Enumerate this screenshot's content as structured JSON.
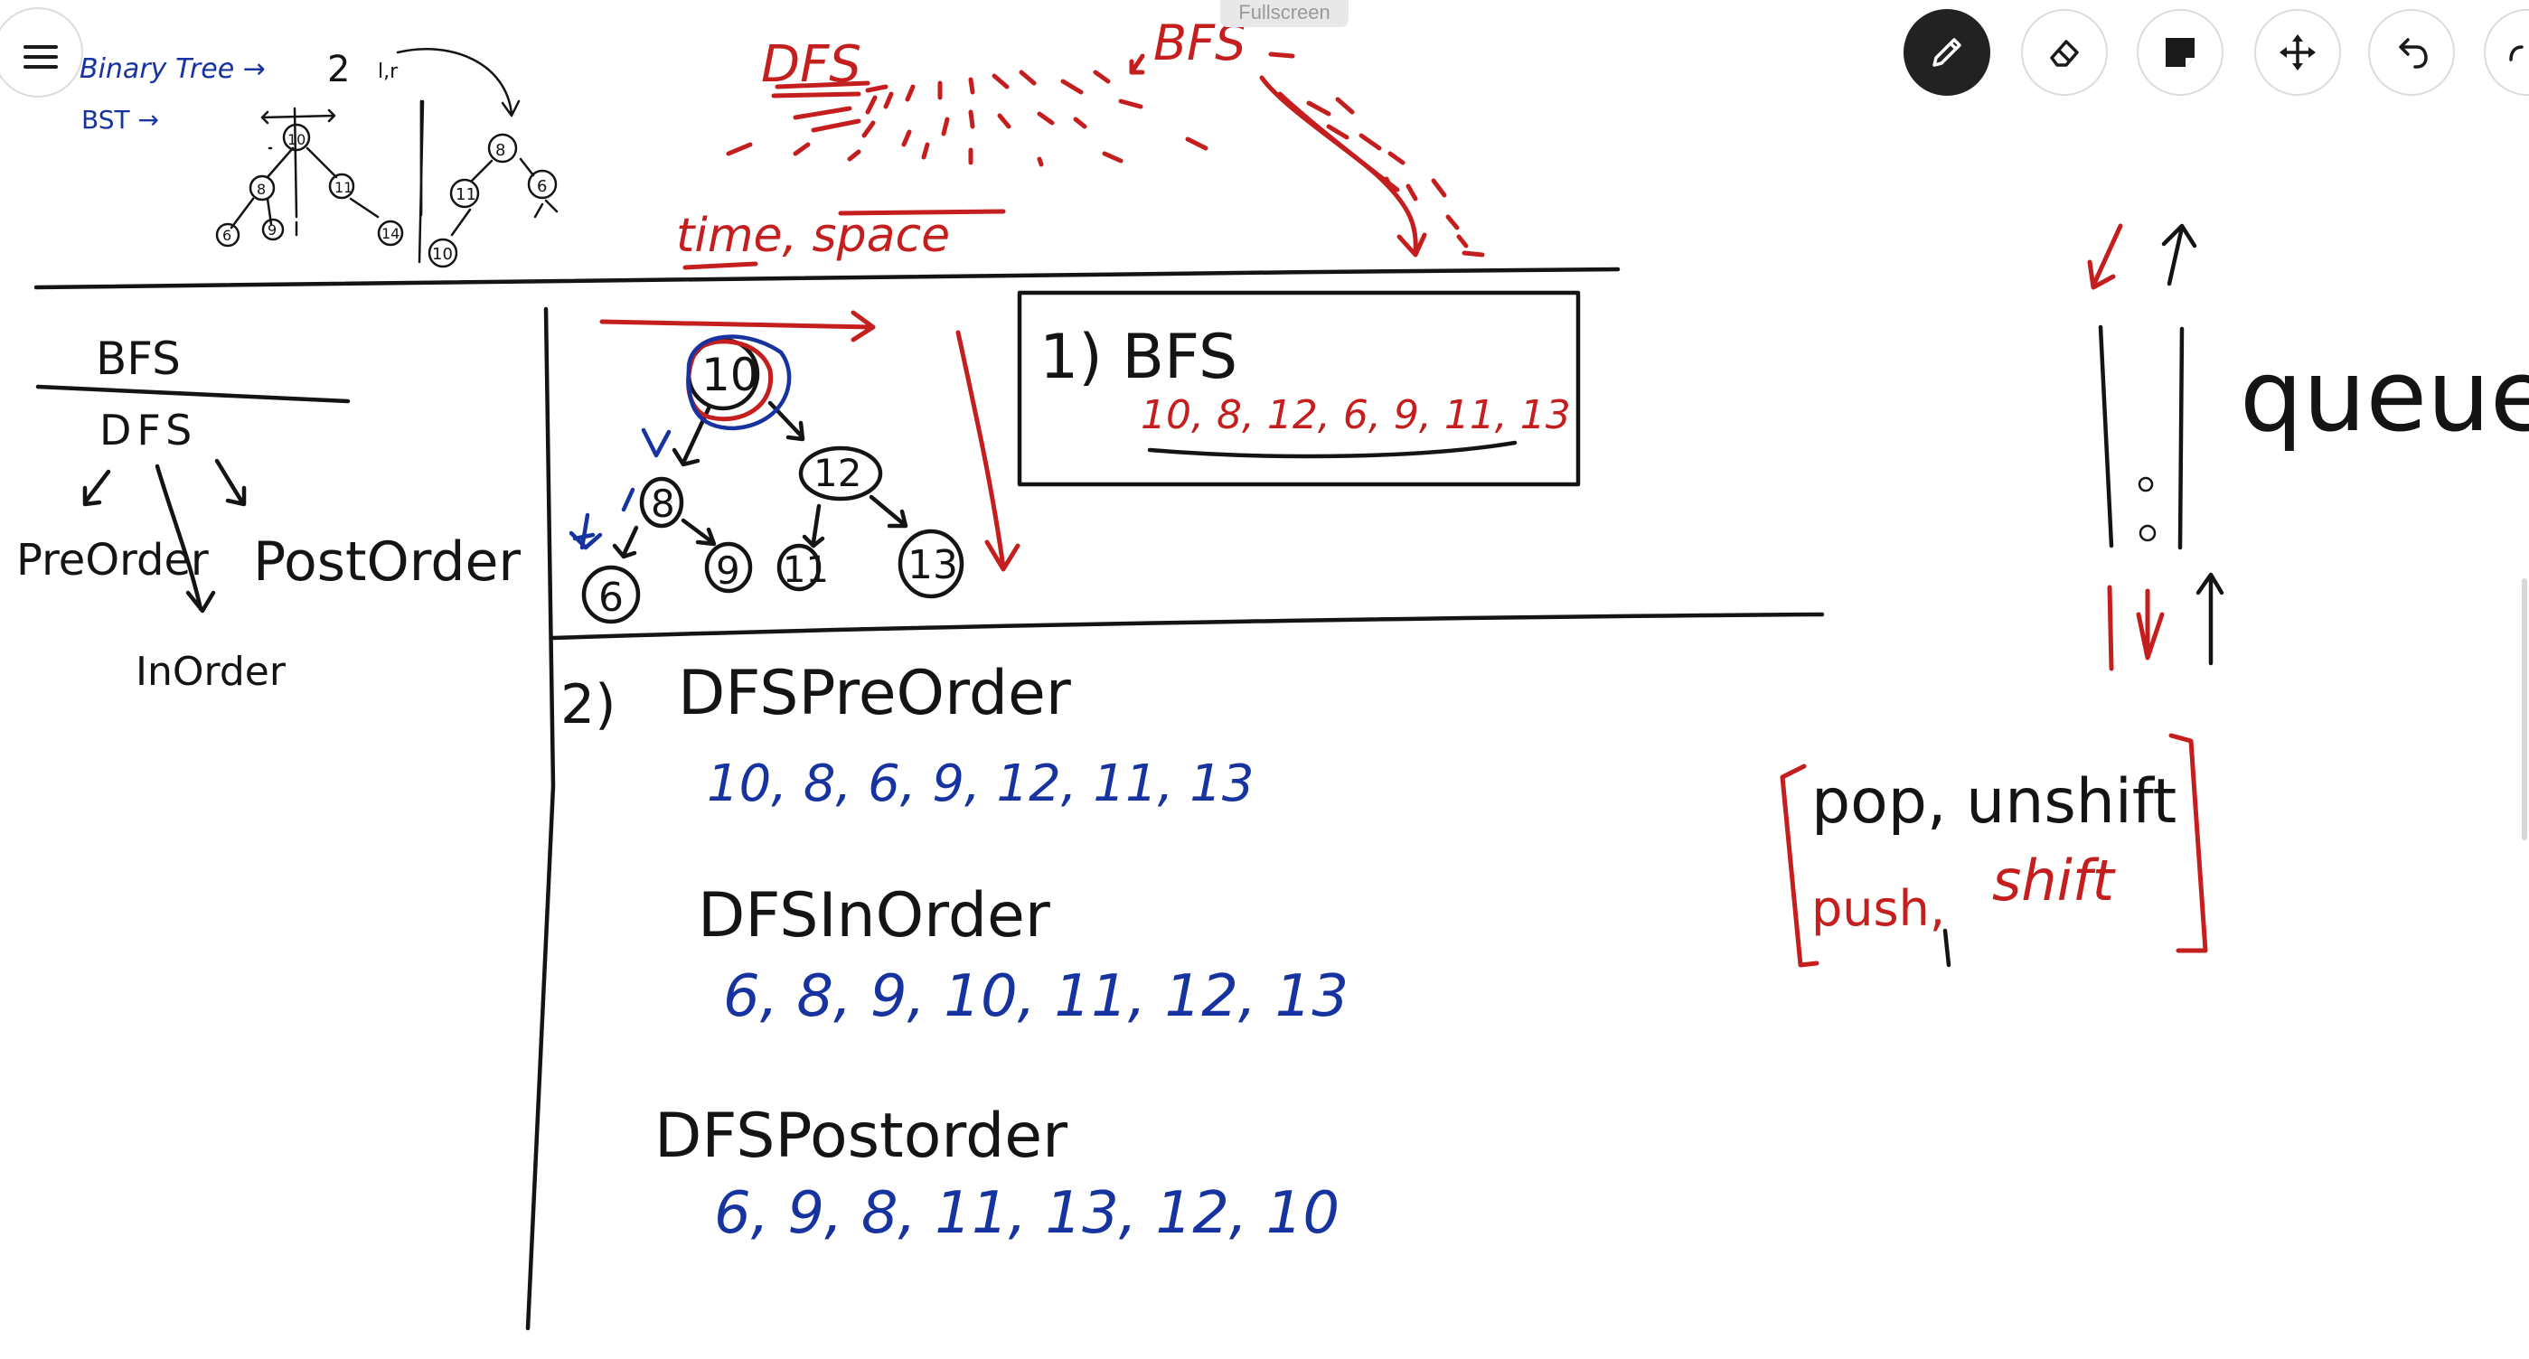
{
  "app": {
    "fullscreen_label": "Fullscreen"
  },
  "toolbar": {
    "tools": [
      {
        "name": "pen",
        "icon": "pencil-icon",
        "active": true
      },
      {
        "name": "eraser",
        "icon": "eraser-icon",
        "active": false
      },
      {
        "name": "sticky-note",
        "icon": "sticky-note-icon",
        "active": false
      },
      {
        "name": "move",
        "icon": "move-icon",
        "active": false
      },
      {
        "name": "undo",
        "icon": "undo-icon",
        "active": false
      },
      {
        "name": "redo",
        "icon": "redo-icon",
        "active": false
      }
    ],
    "menu_icon": "hamburger-icon"
  },
  "colors": {
    "ink_black": "#141414",
    "ink_red": "#c41e1e",
    "ink_blue": "#1633a0",
    "toolbar_active": "#222222"
  },
  "board": {
    "top_left": {
      "binary_tree": "Binary Tree →",
      "binary_tree_count": "2",
      "binary_tree_suffix": "l,r",
      "bst": "BST →",
      "small_tree_nodes": [
        "10",
        "8",
        "11",
        "6",
        "9",
        "14"
      ],
      "right_tree_nodes": [
        "8",
        "6",
        "11",
        "10"
      ]
    },
    "top_center": {
      "dfs": "DFS",
      "bfs": "BFS",
      "time_space": "time, space"
    },
    "left_panel": {
      "bfs": "BFS",
      "dfs": "DFS",
      "preorder": "PreOrder",
      "postorder": "PostOrder",
      "inorder": "InOrder"
    },
    "tree": {
      "nodes": [
        "10",
        "8",
        "12",
        "6",
        "9",
        "11",
        "13"
      ]
    },
    "bfs_box": {
      "label": "1) BFS",
      "sequence": "10, 8, 12, 6, 9, 11, 13"
    },
    "dfs_section": {
      "number": "2)",
      "preorder_title": "DFSPreOrder",
      "preorder_sequence": "10, 8, 6, 9, 12, 11, 13",
      "inorder_title": "DFSInOrder",
      "inorder_sequence": "6, 8, 9, 10, 11, 12, 13",
      "postorder_title": "DFSPostorder",
      "postorder_sequence": "6, 9, 8, 11, 13, 12, 10"
    },
    "queue": {
      "label": "queue",
      "ops_top": "pop, unshift",
      "ops_push": "push,",
      "ops_shift": "shift"
    }
  }
}
